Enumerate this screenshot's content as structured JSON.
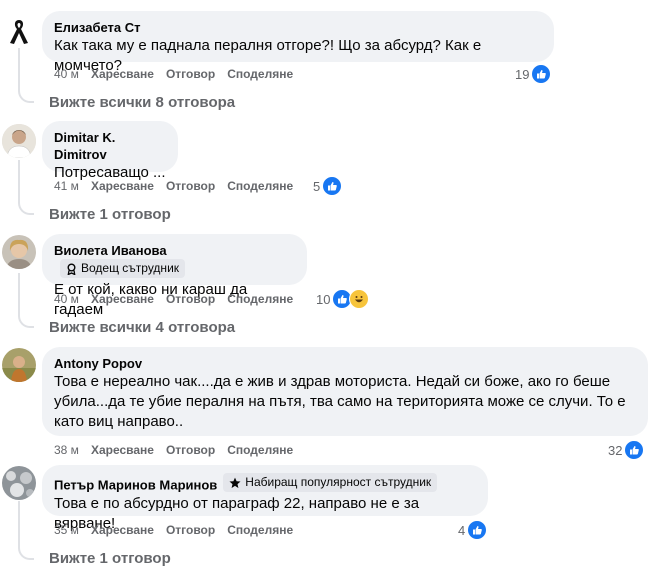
{
  "comments": [
    {
      "author": "Елизабета Ст",
      "avatar": "black-ribbon",
      "badge": null,
      "lines": [
        "Как така му е паднала пералня отгоре?! Що за абсурд? Как е момчето?"
      ],
      "time": "40 м",
      "like_label": "Харесване",
      "reply_label": "Отговор",
      "share_label": "Споделяне",
      "reactions": [
        "like"
      ],
      "reaction_count": "19",
      "replies_label": "Вижте всички 8 отговора"
    },
    {
      "author": "Dimitar K. Dimitrov",
      "avatar": "photo",
      "badge": null,
      "lines": [
        "Потресаващо ..."
      ],
      "time": "41 м",
      "like_label": "Харесване",
      "reply_label": "Отговор",
      "share_label": "Споделяне",
      "reactions": [
        "like"
      ],
      "reaction_count": "5",
      "replies_label": "Вижте 1 отговор"
    },
    {
      "author": "Виолета Иванова",
      "avatar": "photo",
      "badge": {
        "icon": "award-icon",
        "label": "Водещ сътрудник"
      },
      "lines": [
        "Е от кой, какво ни караш да гадаем"
      ],
      "time": "40 м",
      "like_label": "Харесване",
      "reply_label": "Отговор",
      "share_label": "Споделяне",
      "reactions": [
        "like",
        "haha"
      ],
      "reaction_count": "10",
      "replies_label": "Вижте всички 4 отговора"
    },
    {
      "author": "Antony Popov",
      "avatar": "photo",
      "badge": null,
      "lines": [
        "Това е нереално чак....да е жив и здрав моториста. Недай си боже, ако го беше",
        "убила...да те убие пералня на пътя, тва само на територията може се случи. То е",
        "като виц направо.."
      ],
      "time": "38 м",
      "like_label": "Харесване",
      "reply_label": "Отговор",
      "share_label": "Споделяне",
      "reactions": [
        "like"
      ],
      "reaction_count": "32",
      "replies_label": null
    },
    {
      "author": "Петър Маринов Маринов",
      "avatar": "photo",
      "badge": {
        "icon": "star-icon",
        "label": "Набиращ популярност сътрудник"
      },
      "lines": [
        "Това е по абсурдно от параграф 22, направо не е за вярване!"
      ],
      "time": "35 м",
      "like_label": "Харесване",
      "reply_label": "Отговор",
      "share_label": "Споделяне",
      "reactions": [
        "like"
      ],
      "reaction_count": "4",
      "replies_label": "Вижте 1 отговор"
    }
  ],
  "colors": {
    "bubble": "#f0f2f5",
    "secondary_text": "#65676b",
    "like_blue": "#1877f2",
    "haha_yellow": "#f7c43b",
    "thread_line": "#dfe1e5"
  }
}
